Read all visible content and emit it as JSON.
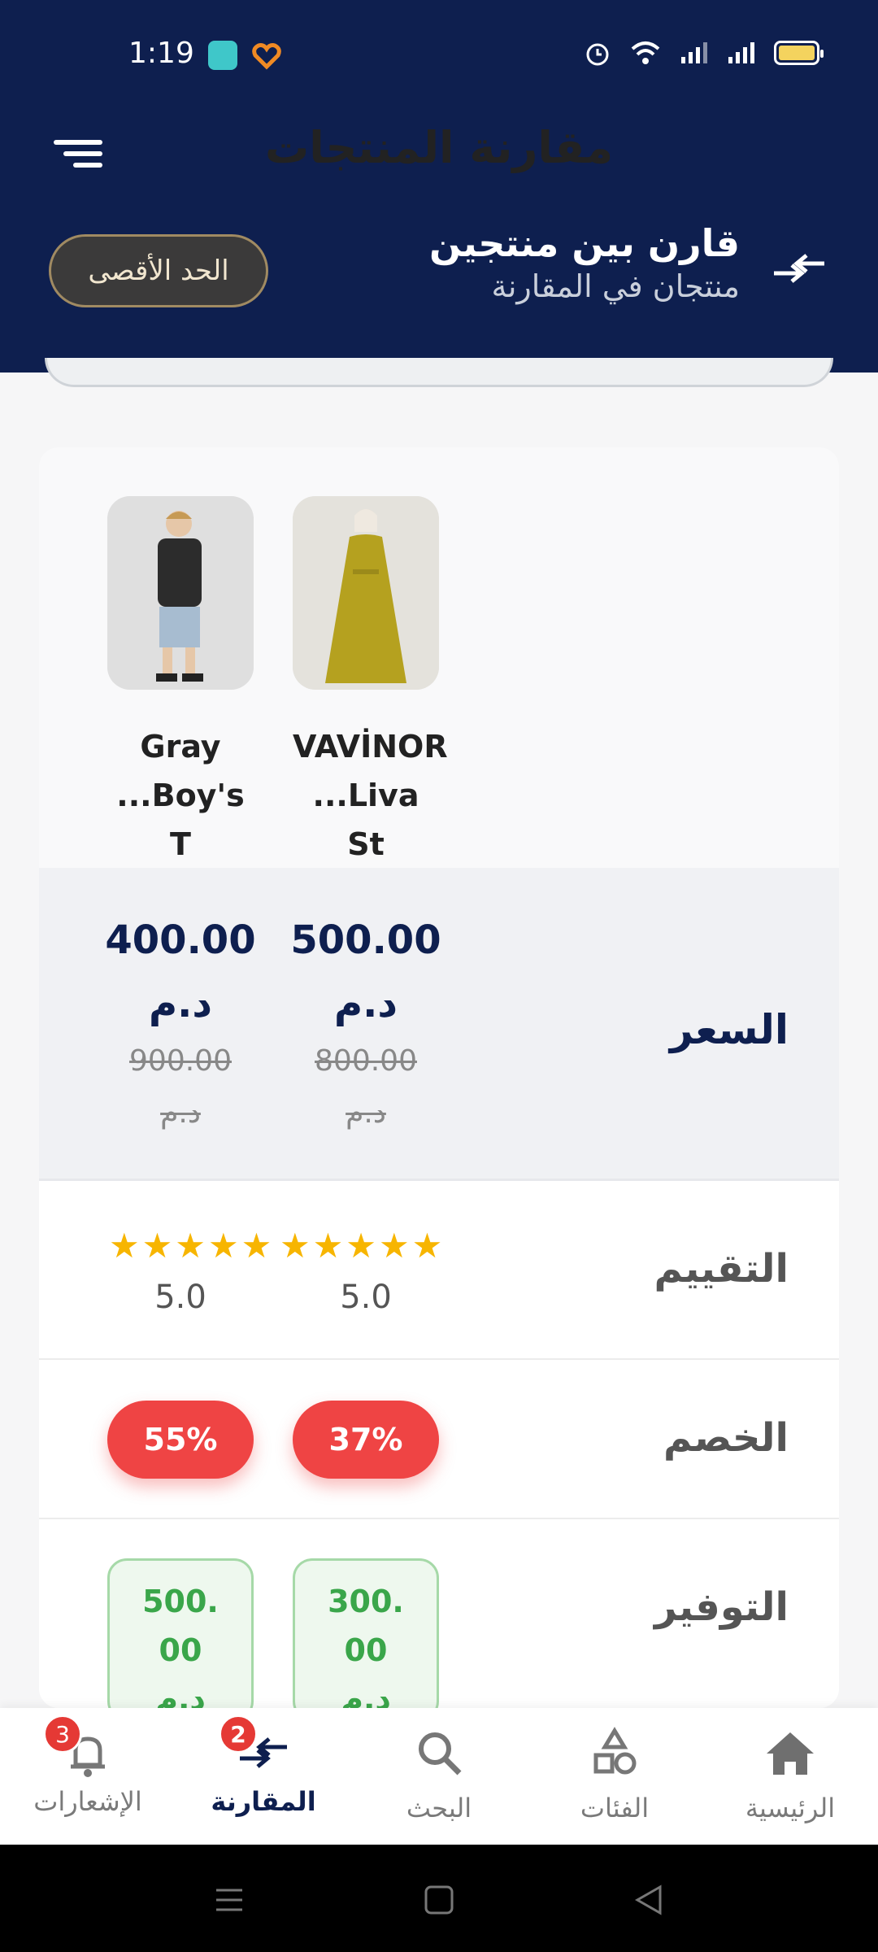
{
  "status": {
    "time": "1:19"
  },
  "header": {
    "title": "مقارنة المنتجات",
    "compare_title": "قارن بين منتجين",
    "compare_subtitle": "منتجان في المقارنة",
    "max_button": "الحد الأقصى"
  },
  "products": [
    {
      "name1": "VAVİNOR",
      "name2": "...Liva St",
      "price": "500.00",
      "currency": "د.م",
      "old_price": "800.00",
      "old_currency": "د.م",
      "rating": "5.0",
      "stars": 5,
      "discount": "37%",
      "saving1": "300.",
      "saving2": "00",
      "saving3": "د.م"
    },
    {
      "name1": "Gray",
      "name2": "...Boy's T",
      "price": "400.00",
      "currency": "د.م",
      "old_price": "900.00",
      "old_currency": "د.م",
      "rating": "5.0",
      "stars": 5,
      "discount": "55%",
      "saving1": "500.",
      "saving2": "00",
      "saving3": "د.م"
    }
  ],
  "rows": {
    "price": "السعر",
    "rating": "التقييم",
    "discount": "الخصم",
    "saving": "التوفير"
  },
  "nav": [
    {
      "label": "الرئيسية",
      "icon": "home-icon"
    },
    {
      "label": "الفئات",
      "icon": "categories-icon"
    },
    {
      "label": "البحث",
      "icon": "search-icon"
    },
    {
      "label": "المقارنة",
      "icon": "compare-icon",
      "badge": "2"
    },
    {
      "label": "الإشعارات",
      "icon": "bell-icon",
      "badge": "3"
    }
  ],
  "colors": {
    "primary": "#0e1f4f",
    "accent": "#ef4444",
    "star": "#f7b500",
    "saving": "#3aa64a"
  }
}
